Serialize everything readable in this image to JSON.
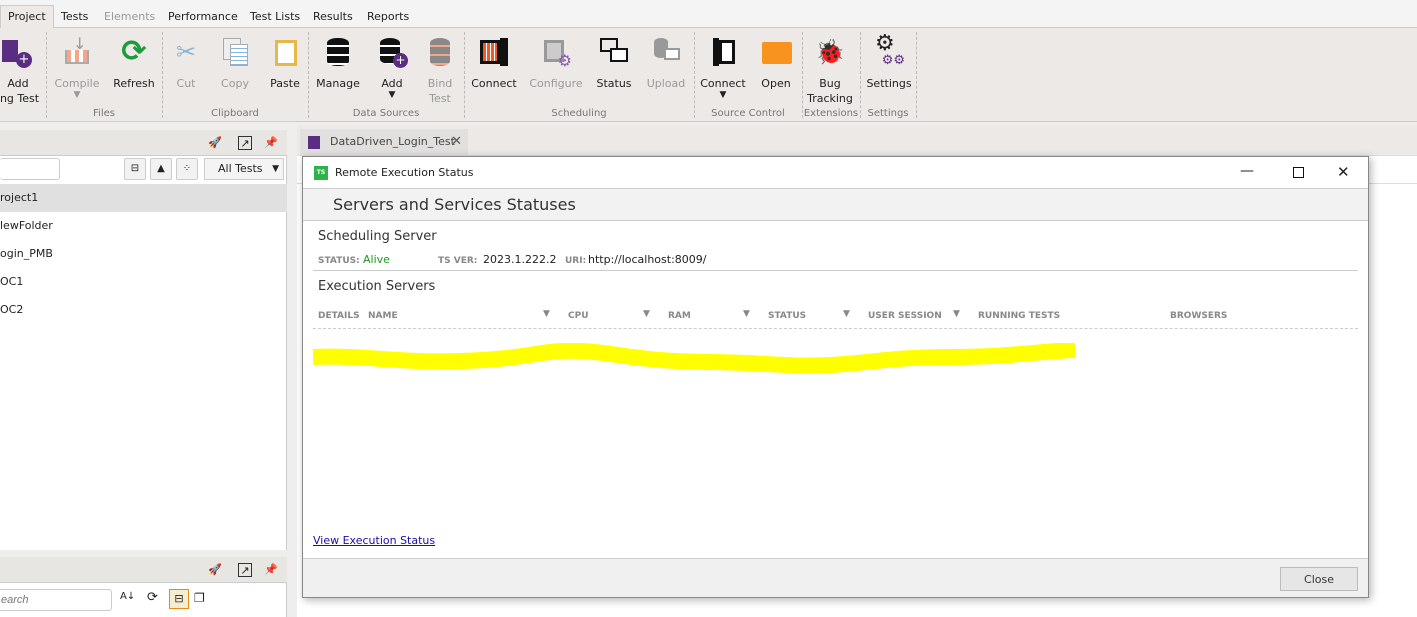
{
  "menu_tabs": [
    "Project",
    "Tests",
    "Elements",
    "Performance",
    "Test Lists",
    "Results",
    "Reports"
  ],
  "ribbon": {
    "add_test": [
      "Add",
      "ing Test"
    ],
    "compile": "Compile",
    "refresh": "Refresh",
    "files": "Files",
    "cut": "Cut",
    "copy": "Copy",
    "paste": "Paste",
    "clipboard": "Clipboard",
    "manage": "Manage",
    "add": "Add",
    "bind": [
      "Bind",
      "Test"
    ],
    "data_sources": "Data Sources",
    "connect": "Connect",
    "configure": "Configure",
    "status": "Status",
    "upload": "Upload",
    "scheduling": "Scheduling",
    "sc_connect": "Connect",
    "open": "Open",
    "source_control": "Source Control",
    "bug": [
      "Bug",
      "Tracking"
    ],
    "extensions": "Extensions",
    "settings": "Settings",
    "settings_group": "Settings"
  },
  "project_panel": {
    "filter": "All Tests",
    "items": [
      "roject1",
      "lewFolder",
      "ogin_PMB",
      "OC1",
      "OC2"
    ]
  },
  "bottom_panel": {
    "search_placeholder": "earch"
  },
  "doc_tab": {
    "label": "DataDriven_Login_Test"
  },
  "dialog": {
    "title": "Remote Execution Status",
    "header": "Servers and Services Statuses",
    "scheduling_title": "Scheduling Server",
    "status_label": "STATUS:",
    "status_value": "Alive",
    "status_color": "#1e9a1e",
    "ver_label": "TS VER:",
    "ver_value": "2023.1.222.2",
    "uri_label": "URI:",
    "uri_value": "http://localhost:8009/",
    "execution_title": "Execution Servers",
    "columns": [
      "DETAILS",
      "NAME",
      "CPU",
      "RAM",
      "STATUS",
      "USER SESSION",
      "RUNNING TESTS",
      "BROWSERS"
    ],
    "link": "View Execution Status",
    "close": "Close"
  }
}
